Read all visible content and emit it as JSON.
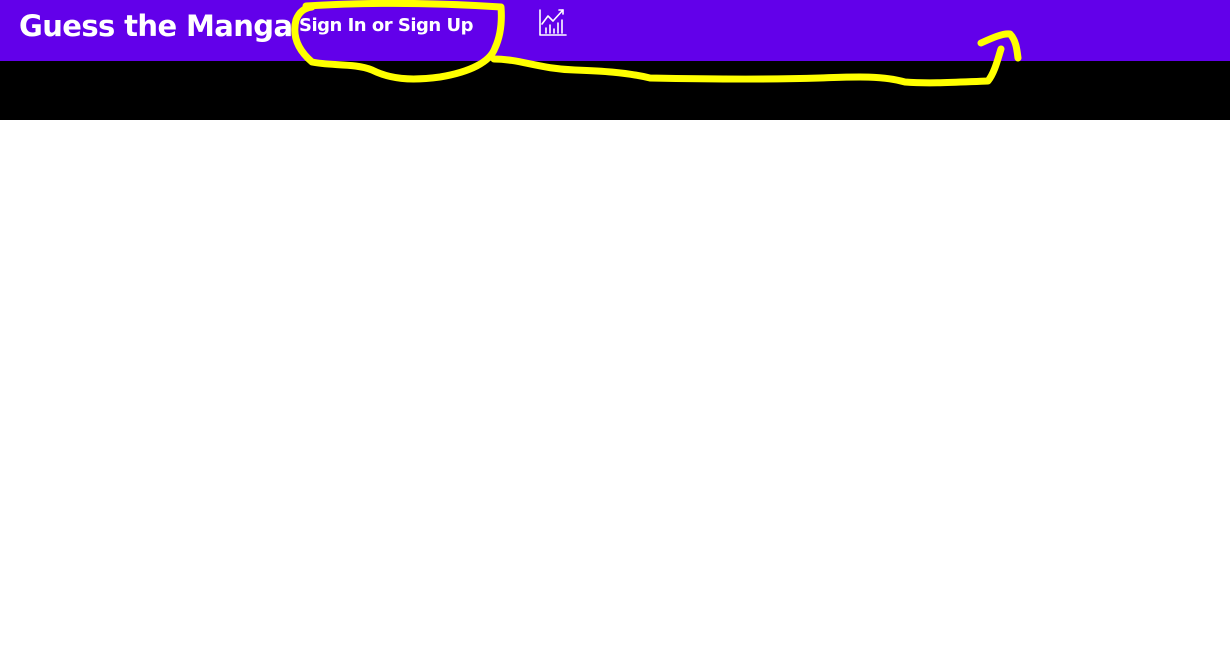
{
  "header": {
    "brand_title": "Guess the Manga",
    "sign_in_label": "Sign In or Sign Up",
    "stats_icon": "line-chart-icon",
    "background_color": "#6200ea",
    "text_color": "#ffffff"
  },
  "banner": {
    "background_color": "#000000"
  },
  "annotation": {
    "color": "#ffff00",
    "shapes": [
      "circle-around-sign-in",
      "arrow-pointing-right"
    ]
  }
}
